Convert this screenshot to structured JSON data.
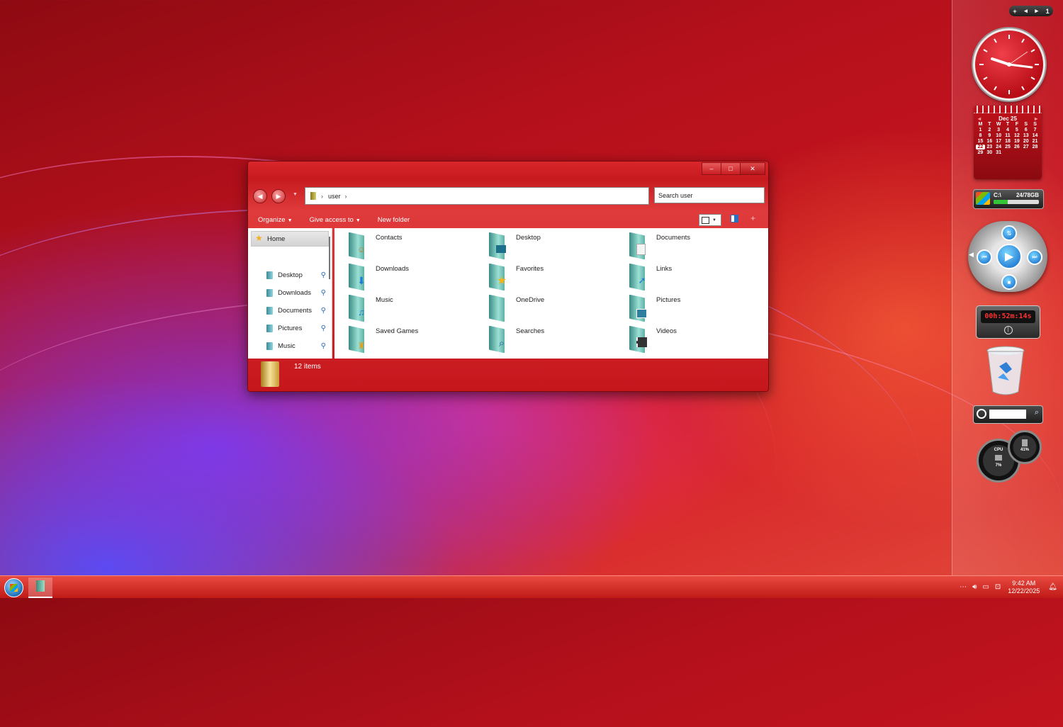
{
  "sidebar": {
    "controls": [
      "+",
      "◂",
      "▸",
      "1"
    ],
    "calendar": {
      "month": "Dec 25",
      "weekdays": [
        "M",
        "T",
        "W",
        "T",
        "F",
        "S",
        "S"
      ],
      "days": [
        "1",
        "2",
        "3",
        "4",
        "5",
        "6",
        "7",
        "8",
        "9",
        "10",
        "11",
        "12",
        "13",
        "14",
        "15",
        "16",
        "17",
        "18",
        "19",
        "20",
        "21",
        "22",
        "23",
        "24",
        "25",
        "26",
        "27",
        "28",
        "29",
        "30",
        "31"
      ],
      "today": "22"
    },
    "drive": {
      "label": "C:\\",
      "size": "24/78GB"
    },
    "timer": "00h:52m:14s",
    "gauges": {
      "cpu_label": "CPU",
      "cpu_value": "7%",
      "ram_value": "41%"
    }
  },
  "window": {
    "address": {
      "folder": "user"
    },
    "search_placeholder": "Search user",
    "toolbar": {
      "organize": "Organize",
      "give_access": "Give access to",
      "new_folder": "New folder"
    },
    "nav": {
      "home": "Home",
      "items": [
        "Desktop",
        "Downloads",
        "Documents",
        "Pictures",
        "Music"
      ]
    },
    "items": [
      {
        "label": "Contacts",
        "icon": "contacts-icon"
      },
      {
        "label": "Desktop",
        "icon": "desktop-icon"
      },
      {
        "label": "Documents",
        "icon": "documents-icon"
      },
      {
        "label": "Downloads",
        "icon": "downloads-icon"
      },
      {
        "label": "Favorites",
        "icon": "star-icon"
      },
      {
        "label": "Links",
        "icon": "links-icon"
      },
      {
        "label": "Music",
        "icon": "music-icon"
      },
      {
        "label": "OneDrive",
        "icon": "onedrive-icon"
      },
      {
        "label": "Pictures",
        "icon": "pictures-icon"
      },
      {
        "label": "Saved Games",
        "icon": "games-icon"
      },
      {
        "label": "Searches",
        "icon": "search-icon"
      },
      {
        "label": "Videos",
        "icon": "videos-icon"
      }
    ],
    "status": "12 items"
  },
  "taskbar": {
    "time": "9:42 AM",
    "date": "12/22/2025"
  }
}
